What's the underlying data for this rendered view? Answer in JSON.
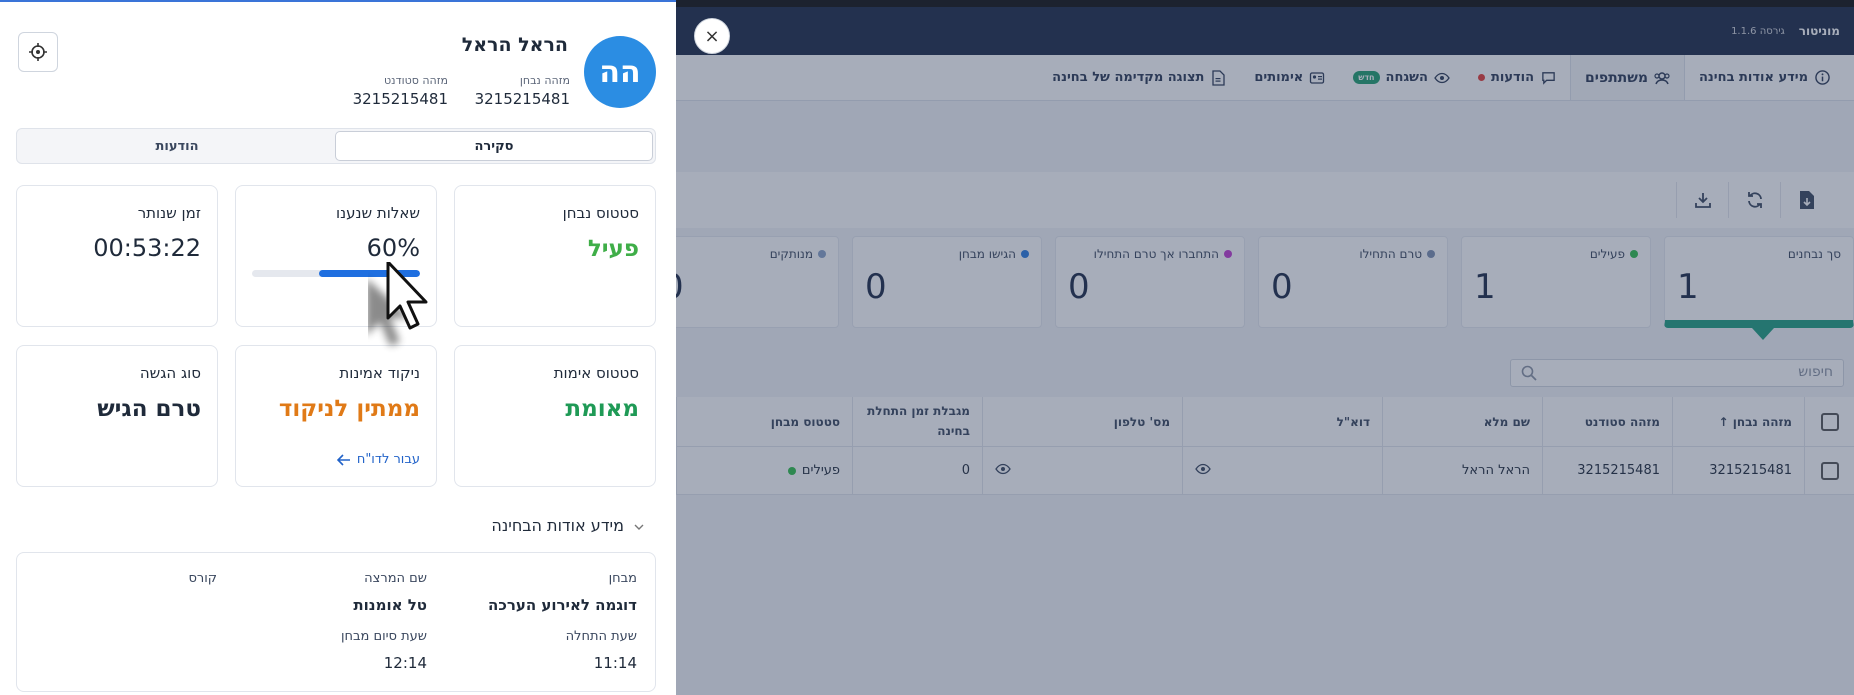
{
  "app": {
    "name": "מוניטור",
    "version": "גירסה 1.1.6"
  },
  "tabs": [
    {
      "label": "מידע אודות בחינה",
      "icon": "info-icon"
    },
    {
      "label": "משתתפים",
      "icon": "participants-icon",
      "active": true
    },
    {
      "label": "הודעות",
      "icon": "chat-icon",
      "alert": true
    },
    {
      "label": "השגחה",
      "icon": "eye-icon",
      "badge": "חדש"
    },
    {
      "label": "אימותים",
      "icon": "id-card-icon"
    },
    {
      "label": "תצוגה מקדימה של בחינה",
      "icon": "file-icon"
    }
  ],
  "stats": [
    {
      "label": "סך נבחנים",
      "value": "1",
      "color": ""
    },
    {
      "label": "פעילים",
      "value": "1",
      "color": "#2fbf4a"
    },
    {
      "label": "טרם התחילו",
      "value": "0",
      "color": "#7d8fb0"
    },
    {
      "label": "התחברו אך טרם התחילו",
      "value": "0",
      "color": "#c23bd1"
    },
    {
      "label": "הגישו מבחן",
      "value": "0",
      "color": "#2b7de0"
    },
    {
      "label": "מנותקים",
      "value": "0",
      "color": "#8aa3c8"
    }
  ],
  "search": {
    "placeholder": "חיפוש"
  },
  "table": {
    "headers": [
      "מזהה נבחן",
      "מזהה סטודנט",
      "שם מלא",
      "דוא\"ל",
      "מס' טלפון",
      "מגבלת זמן התחלת בחינה",
      "סטטוס מבחן"
    ],
    "rows": [
      {
        "examinee_id": "3215215481",
        "student_id": "3215215481",
        "full_name": "הראל הראל",
        "limit": "0",
        "status": "פעילים"
      }
    ]
  },
  "panel": {
    "close": "×",
    "avatar_initials": "הה",
    "name": "הראל הראל",
    "examinee_id_label": "מזהה נבחן",
    "examinee_id": "3215215481",
    "student_id_label": "מזהה סטודנט",
    "student_id": "3215215481",
    "segments": {
      "overview": "סקירה",
      "messages": "הודעות"
    },
    "cards": {
      "exam_status": {
        "title": "סטטוס נבחן",
        "value": "פעיל",
        "color": "#3fae48"
      },
      "answered": {
        "title": "שאלות שנענו",
        "value": "60%",
        "progress": 0.6
      },
      "time_left": {
        "title": "זמן שנותר",
        "value": "00:53:22"
      },
      "auth_status": {
        "title": "סטטוס אימות",
        "value": "מאומת",
        "color": "#1f9a56"
      },
      "integrity": {
        "title": "ניקוד אמינות",
        "value": "ממתין לניקוד",
        "color": "#e07a17",
        "link": "עבור לדו\"ח"
      },
      "submit_type": {
        "title": "סוג הגשה",
        "value": "טרם הגיש"
      }
    },
    "exam_info": {
      "header": "מידע אודות הבחינה",
      "exam_label": "מבחן",
      "exam_value": "דוגמה לאירוע הערכה",
      "lecturer_label": "שם המרצה",
      "lecturer_value": "טל אומנות",
      "course_label": "קורס",
      "start_label": "שעת התחלה",
      "start_value": "11:14",
      "end_label": "שעת סיום מבחן",
      "end_value": "12:14"
    }
  }
}
